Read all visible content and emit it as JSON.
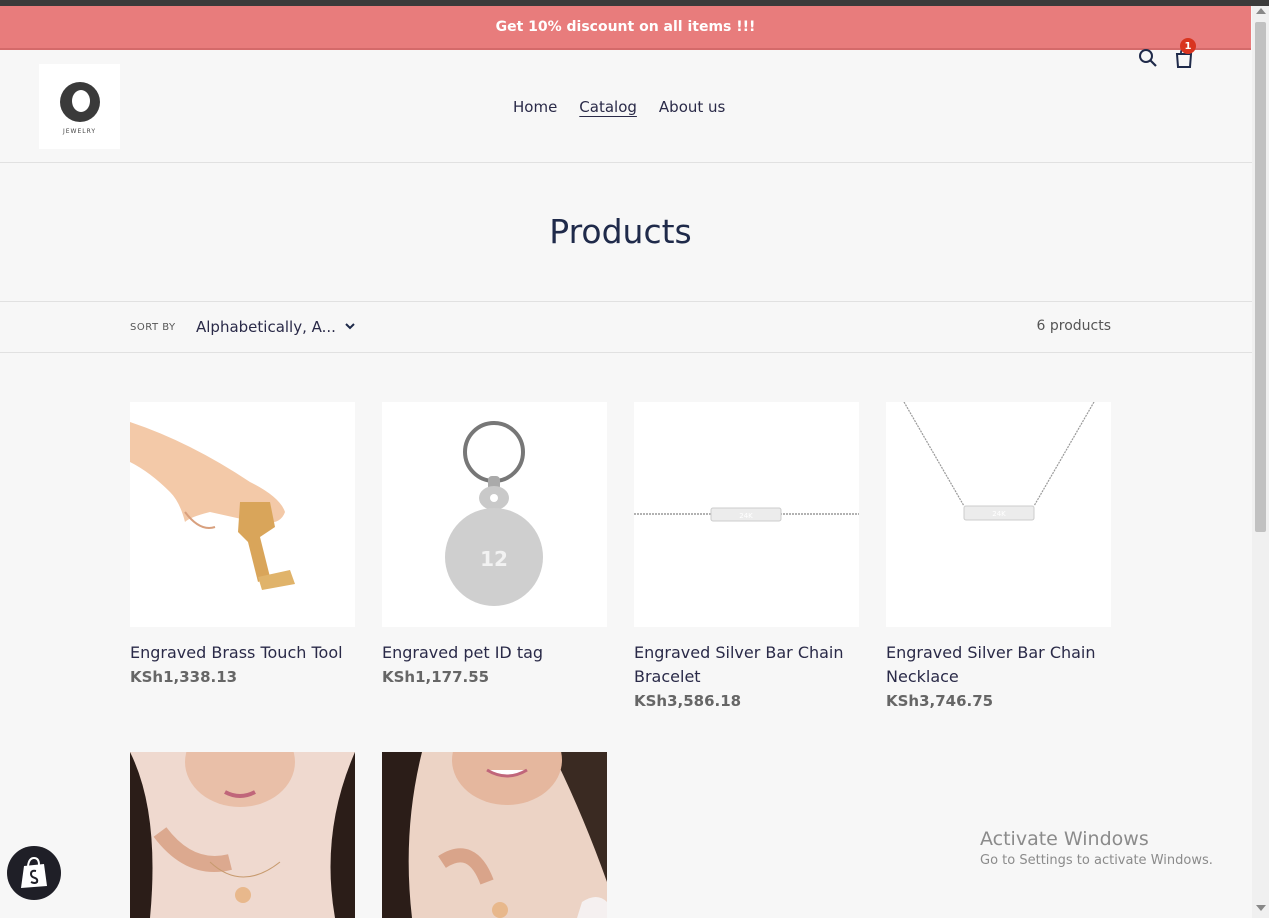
{
  "announcement": "Get 10% discount on all items !!!",
  "logo_text": "JEWELRY",
  "nav": [
    "Home",
    "Catalog",
    "About us"
  ],
  "cart_count": "1",
  "page_title": "Products",
  "sort": {
    "label": "SORT BY",
    "value": "Alphabetically, A..."
  },
  "product_count": "6 products",
  "products": [
    {
      "name": "Engraved Brass Touch Tool",
      "price": "KSh1,338.13"
    },
    {
      "name": "Engraved pet ID tag",
      "price": "KSh1,177.55",
      "tag_text": "12"
    },
    {
      "name": "Engraved Silver Bar Chain Bracelet",
      "price": "KSh3,586.18",
      "bar_text": "24K"
    },
    {
      "name": "Engraved Silver Bar Chain Necklace",
      "price": "KSh3,746.75",
      "bar_text": "24K"
    },
    {
      "name": "",
      "price": ""
    },
    {
      "name": "",
      "price": ""
    }
  ],
  "watermark": {
    "line1": "Activate Windows",
    "line2": "Go to Settings to activate Windows."
  },
  "colors": {
    "announcement_bg": "#e87c7c",
    "badge": "#d9341f",
    "title": "#1f2a4a"
  }
}
